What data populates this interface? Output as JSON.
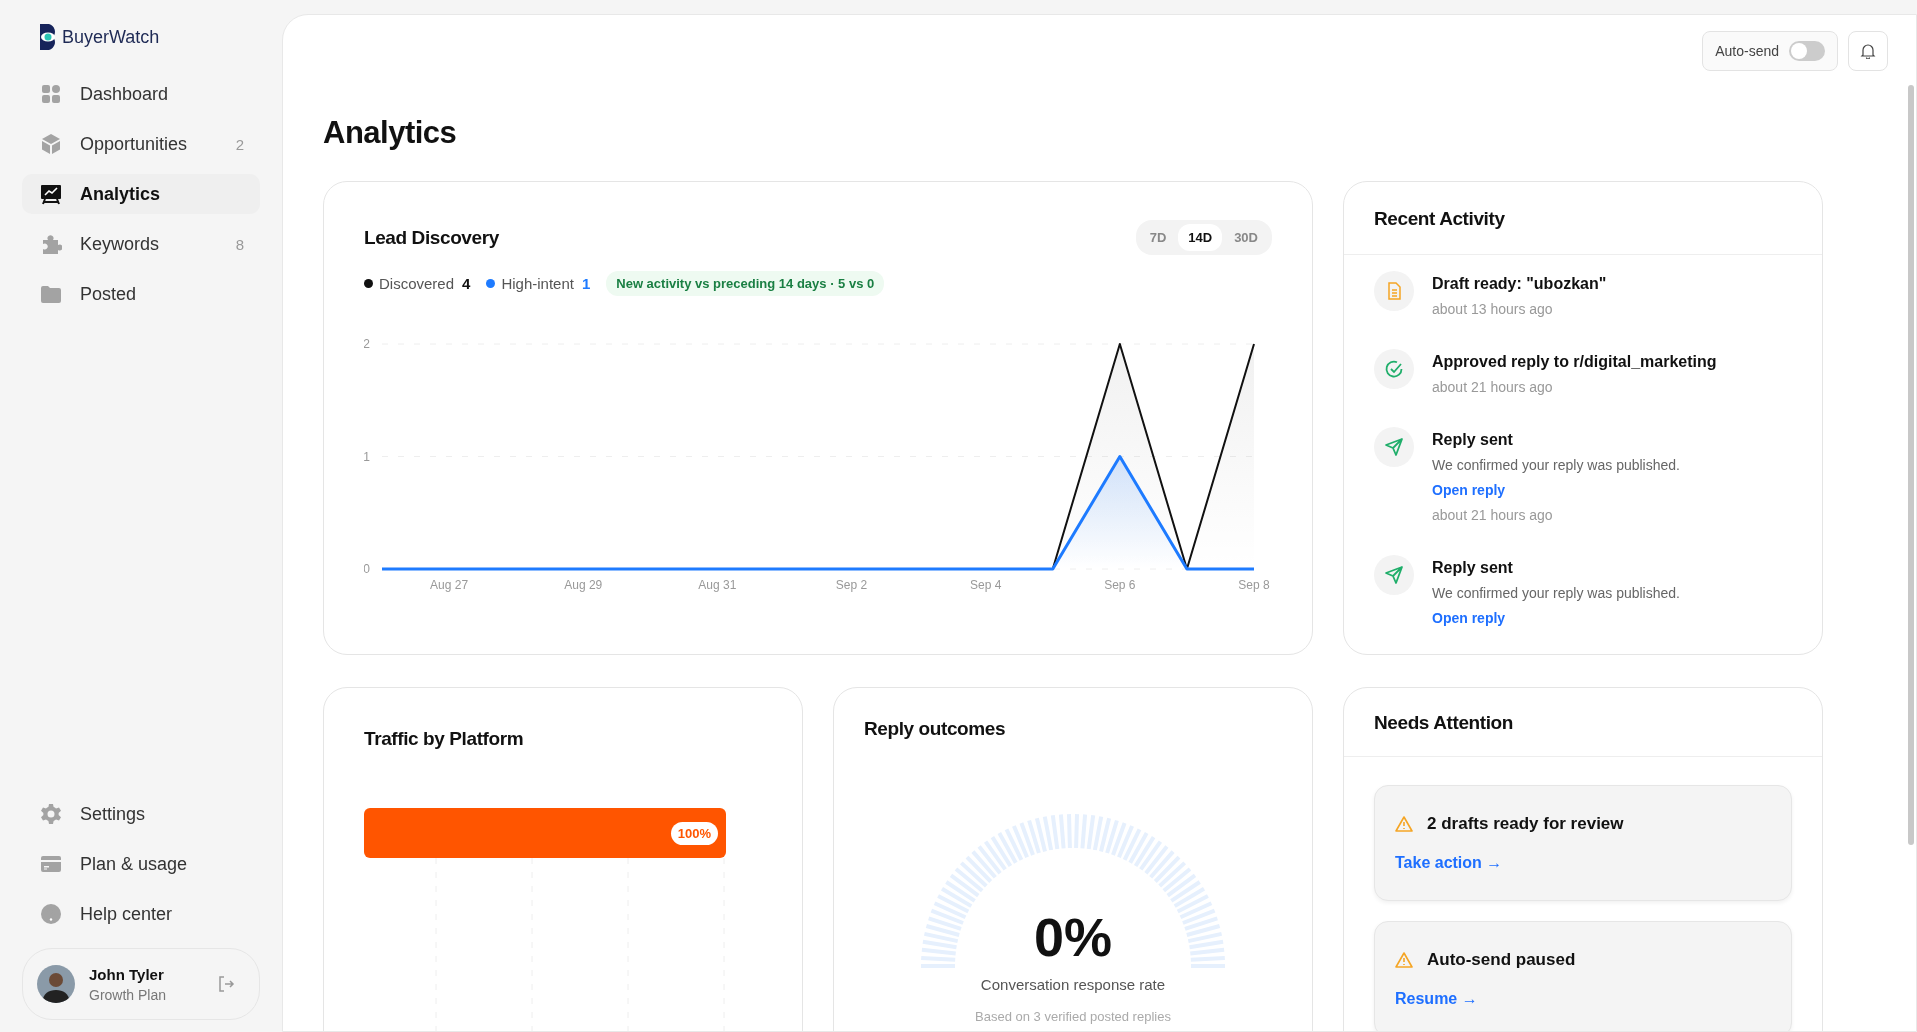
{
  "brand": {
    "name": "BuyerWatch"
  },
  "nav": [
    {
      "label": "Dashboard",
      "selected": false
    },
    {
      "label": "Opportunities",
      "count": "2",
      "selected": false
    },
    {
      "label": "Analytics",
      "selected": true
    },
    {
      "label": "Keywords",
      "count": "8",
      "selected": false
    },
    {
      "label": "Posted",
      "selected": false
    }
  ],
  "nav_bottom": [
    {
      "label": "Settings"
    },
    {
      "label": "Plan & usage"
    },
    {
      "label": "Help center"
    }
  ],
  "user": {
    "name": "John Tyler",
    "plan": "Growth Plan"
  },
  "topbar": {
    "auto_send": {
      "label": "Auto-send",
      "on": false
    }
  },
  "page_title": "Analytics",
  "lead_discovery": {
    "title": "Lead Discovery",
    "ranges": [
      {
        "label": "7D",
        "selected": false
      },
      {
        "label": "14D",
        "selected": true
      },
      {
        "label": "30D",
        "selected": false
      }
    ],
    "totals": [
      "4",
      "1"
    ],
    "comparison": "New activity vs preceding 14 days · 5 vs 0",
    "chart_data": {
      "type": "area",
      "categories": [
        null,
        "Aug 27",
        null,
        "Aug 29",
        null,
        "Aug 31",
        null,
        "Sep 2",
        null,
        "Sep 4",
        null,
        "Sep 6",
        null,
        "Sep 8"
      ],
      "ylim": [
        0,
        2
      ],
      "yticks": [
        0,
        1,
        2
      ],
      "series": [
        {
          "name": "Discovered",
          "color": "#111111",
          "values": [
            null,
            null,
            null,
            null,
            null,
            null,
            null,
            null,
            null,
            null,
            0,
            2,
            0,
            2
          ]
        },
        {
          "name": "High-intent",
          "color": "#1e7bff",
          "values": [
            0,
            0,
            0,
            0,
            0,
            0,
            0,
            0,
            0,
            0,
            0,
            1,
            0,
            0
          ]
        }
      ]
    }
  },
  "recent_activity": {
    "title": "Recent Activity",
    "items": [
      {
        "kind": "draft",
        "title": "Draft ready: \"ubozkan\"",
        "time": "about 13 hours ago"
      },
      {
        "kind": "approved",
        "title": "Approved reply to r/digital_marketing",
        "time": "about 21 hours ago"
      },
      {
        "kind": "sent",
        "title": "Reply sent",
        "description": "We confirmed your reply was published.",
        "link": "Open reply",
        "time": "about 21 hours ago"
      },
      {
        "kind": "sent",
        "title": "Reply sent",
        "description": "We confirmed your reply was published.",
        "link": "Open reply"
      }
    ]
  },
  "traffic": {
    "title": "Traffic by Platform",
    "bars": [
      {
        "level": 1,
        "label": "100%",
        "color": "#ff5500"
      }
    ]
  },
  "reply_outcomes": {
    "title": "Reply outcomes",
    "value": "0%",
    "caption": "Conversation response rate",
    "note": "Based on 3 verified posted replies"
  },
  "needs_attention": {
    "title": "Needs Attention",
    "items": [
      {
        "title": "2 drafts ready for review",
        "action": "Take action →"
      },
      {
        "title": "Auto-send paused",
        "action": "Resume →"
      }
    ]
  }
}
